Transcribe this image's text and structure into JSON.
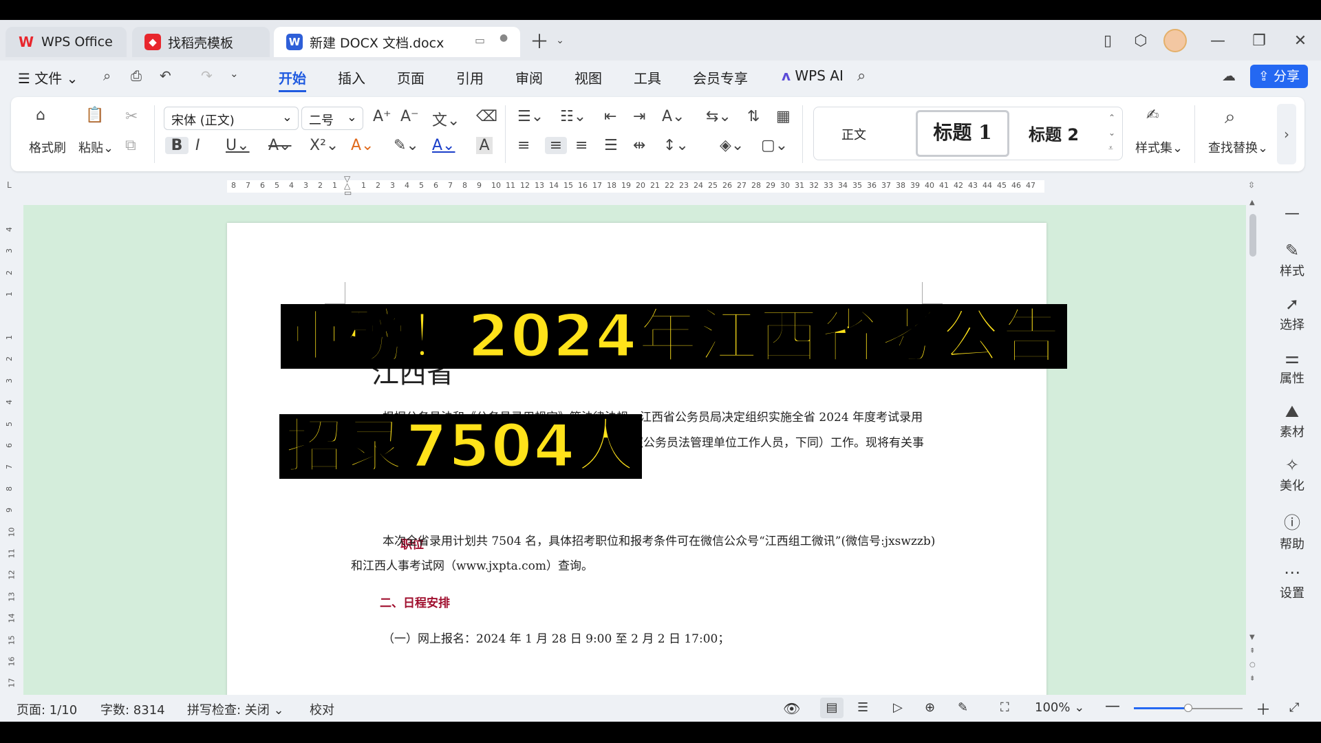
{
  "tabs": [
    {
      "label": "WPS Office"
    },
    {
      "label": "找稻壳模板"
    },
    {
      "label": "新建 DOCX 文档.docx"
    }
  ],
  "menu": {
    "file": "文件",
    "items": [
      "开始",
      "插入",
      "页面",
      "引用",
      "审阅",
      "视图",
      "工具",
      "会员专享"
    ],
    "ai": "WPS AI",
    "share": "分享"
  },
  "ribbon": {
    "format_painter": "格式刷",
    "paste": "粘贴",
    "font": "宋体 (正文)",
    "size": "二号",
    "styles": [
      "正文",
      "标题  1",
      "标题  2"
    ],
    "style_set": "样式集",
    "find_replace": "查找替换"
  },
  "ruler": {
    "ticks": [
      "8",
      "7",
      "6",
      "5",
      "4",
      "3",
      "2",
      "1",
      "",
      "1",
      "2",
      "3",
      "4",
      "5",
      "6",
      "7",
      "8",
      "9",
      "10",
      "11",
      "12",
      "13",
      "14",
      "15",
      "16",
      "17",
      "18",
      "19",
      "20",
      "21",
      "22",
      "23",
      "24",
      "25",
      "26",
      "27",
      "28",
      "29",
      "30",
      "31",
      "32",
      "33",
      "34",
      "35",
      "36",
      "37",
      "38",
      "39",
      "40",
      "41",
      "42",
      "43",
      "44",
      "45",
      "46",
      "47"
    ],
    "vticks": [
      "4",
      "3",
      "2",
      "1",
      "",
      "1",
      "2",
      "3",
      "4",
      "5",
      "6",
      "7",
      "8",
      "9",
      "10",
      "11",
      "12",
      "13",
      "14",
      "15",
      "16",
      "17"
    ]
  },
  "document": {
    "title_partial": "江西省",
    "para1_line1": "根据公务员法和《公务员录用规定》等法律法规，江西省公务员局决定组织实施全省 2024 年度考试录用",
    "para1_line2": "一级主任科员及以下和其他相当职级层次公务员（含参照公务员法管理单位工作人员，下同）工作。现将有关事",
    "heading1_partial": "职位",
    "para2_line1": "本次全省录用计划共 7504 名，具体招考职位和报考条件可在微信公众号“江西组工微讯”(微信号:jxswzzb)",
    "para2_line2": "和江西人事考试网（www.jxpta.com）查询。",
    "heading2": "二、日程安排",
    "item1": "（一）网上报名：2024 年 1 月 28 日 9:00 至 2 月 2 日 17:00；"
  },
  "overlay": {
    "line1": "重磅！2024年江西省考公告",
    "line2": "招录7504人"
  },
  "right_panel": [
    "样式",
    "选择",
    "属性",
    "素材",
    "美化",
    "帮助",
    "设置"
  ],
  "status": {
    "page": "页面: 1/10",
    "words": "字数: 8314",
    "spell": "拼写检查: 关闭",
    "proof": "校对",
    "zoom": "100%"
  },
  "colors": {
    "canvas": "#d4eddb",
    "accent": "#2468f2",
    "heading": "#a0102f",
    "overlay_text": "#ffe21a"
  }
}
